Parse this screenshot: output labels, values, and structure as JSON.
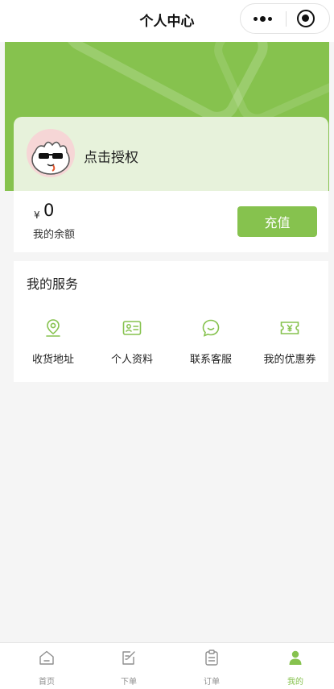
{
  "nav": {
    "title": "个人中心"
  },
  "user": {
    "name": "点击授权"
  },
  "balance": {
    "currency": "¥",
    "amount": "0",
    "label": "我的余额",
    "recharge_label": "充值"
  },
  "services": {
    "title": "我的服务",
    "items": [
      {
        "label": "收货地址",
        "icon": "location-icon"
      },
      {
        "label": "个人资料",
        "icon": "id-card-icon"
      },
      {
        "label": "联系客服",
        "icon": "chat-icon"
      },
      {
        "label": "我的优惠券",
        "icon": "coupon-icon"
      }
    ]
  },
  "tabbar": {
    "items": [
      {
        "label": "首页",
        "icon": "home-icon",
        "active": false
      },
      {
        "label": "下单",
        "icon": "edit-icon",
        "active": false
      },
      {
        "label": "订单",
        "icon": "clipboard-icon",
        "active": false
      },
      {
        "label": "我的",
        "icon": "user-icon",
        "active": true
      }
    ]
  },
  "colors": {
    "accent": "#86c24e",
    "background": "#f5f5f5",
    "user_card": "#e7f2db"
  }
}
